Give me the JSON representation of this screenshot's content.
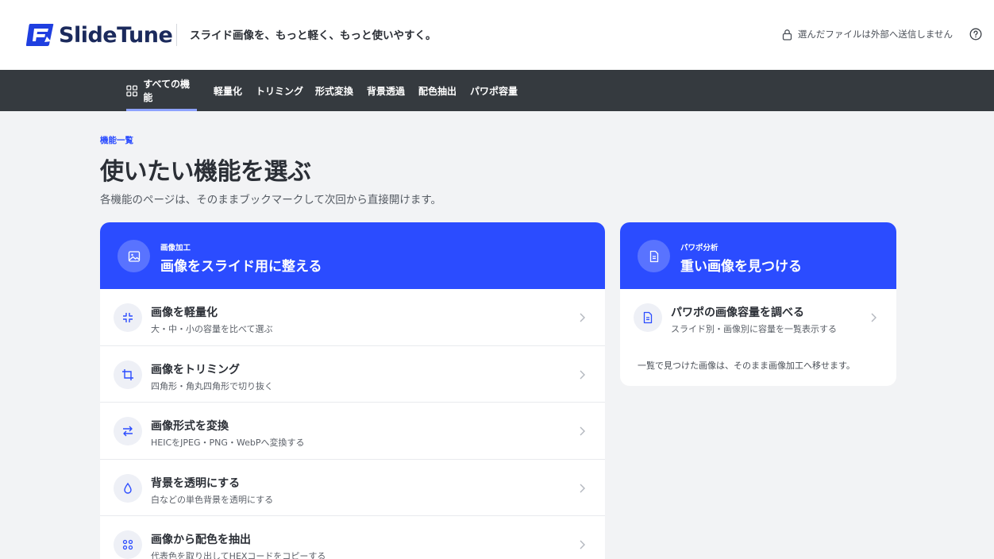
{
  "header": {
    "logo_text": "SlideTune",
    "tagline": "スライド画像を、もっと軽く、もっと使いやすく。",
    "privacy_text": "選んだファイルは外部へ送信しません",
    "help_icon": "question-circle-icon",
    "lock_icon": "lock-icon"
  },
  "nav": {
    "items": [
      {
        "label": "すべての機能",
        "icon": "grid-icon",
        "active": true
      },
      {
        "label": "軽量化"
      },
      {
        "label": "トリミング"
      },
      {
        "label": "形式変換"
      },
      {
        "label": "背景透過"
      },
      {
        "label": "配色抽出"
      },
      {
        "label": "パワポ容量"
      }
    ]
  },
  "intro": {
    "eyebrow": "機能一覧",
    "title": "使いたい機能を選ぶ",
    "subtitle": "各機能のページは、そのままブックマークして次回から直接開けます。"
  },
  "cards": [
    {
      "eyebrow": "画像加工",
      "title": "画像をスライド用に整える",
      "icon": "image-icon",
      "items": [
        {
          "title": "画像を軽量化",
          "sub": "大・中・小の容量を比べて選ぶ",
          "icon": "compress-icon"
        },
        {
          "title": "画像をトリミング",
          "sub": "四角形・角丸四角形で切り抜く",
          "icon": "crop-icon"
        },
        {
          "title": "画像形式を変換",
          "sub": "HEICをJPEG・PNG・WebPへ変換する",
          "icon": "swap-icon"
        },
        {
          "title": "背景を透明にする",
          "sub": "白などの単色背景を透明にする",
          "icon": "drop-icon"
        },
        {
          "title": "画像から配色を抽出",
          "sub": "代表色を取り出してHEXコードをコピーする",
          "icon": "palette-icon"
        }
      ]
    },
    {
      "eyebrow": "パワポ分析",
      "title": "重い画像を見つける",
      "icon": "document-icon",
      "items": [
        {
          "title": "パワポの画像容量を調べる",
          "sub": "スライド別・画像別に容量を一覧表示する",
          "icon": "file-icon"
        }
      ],
      "note": "一覧で見つけた画像は、そのまま画像加工へ移せます。"
    }
  ],
  "colors": {
    "accent": "#2b4cff",
    "nav_bg": "#353a3f",
    "page_bg": "#f2f3f5"
  }
}
